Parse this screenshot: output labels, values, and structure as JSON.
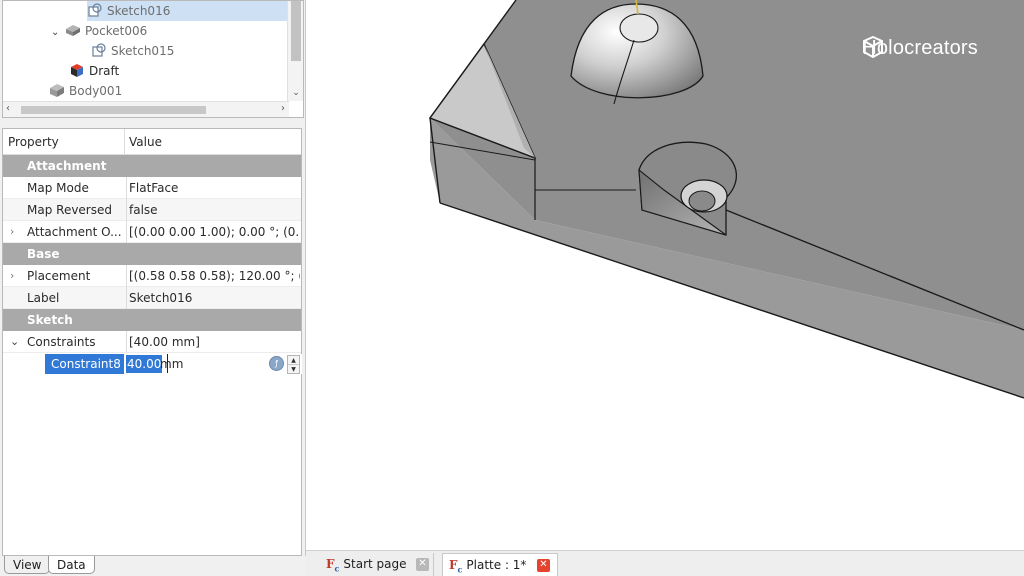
{
  "tree": {
    "items": [
      {
        "label": "Sketch016",
        "kind": "sketch"
      },
      {
        "label": "Pocket006",
        "kind": "pocket"
      },
      {
        "label": "Sketch015",
        "kind": "sketch"
      },
      {
        "label": "Draft",
        "kind": "draft"
      },
      {
        "label": "Body001",
        "kind": "body"
      }
    ]
  },
  "properties": {
    "header_property": "Property",
    "header_value": "Value",
    "groups": [
      {
        "name": "Attachment"
      },
      {
        "name": "Base"
      },
      {
        "name": "Sketch"
      }
    ],
    "rows": [
      {
        "name": "Map Mode",
        "value": "FlatFace"
      },
      {
        "name": "Map Reversed",
        "value": "false"
      },
      {
        "name": "Attachment O...",
        "value": "[(0.00 0.00 1.00); 0.00 °; (0.00 ..."
      },
      {
        "name": "Placement",
        "value": "[(0.58 0.58 0.58); 120.00 °; (0...."
      },
      {
        "name": "Label",
        "value": "Sketch016"
      },
      {
        "name": "Constraints",
        "value": "[40.00 mm]"
      }
    ],
    "editing": {
      "name": "Constraint8",
      "selected_value": "40.00",
      "unit": "mm"
    }
  },
  "bottom_tabs": [
    {
      "label": "View"
    },
    {
      "label": "Data"
    }
  ],
  "doc_tabs": [
    {
      "label": "Start page",
      "active": false
    },
    {
      "label": "Platte : 1*",
      "active": true
    }
  ],
  "watermark": {
    "text": "Holocreators"
  },
  "colors": {
    "selection": "#3079d6",
    "group_header": "#a9a9a9",
    "model_face": "#8f8f8f",
    "close_active": "#e4442f"
  },
  "icons": {
    "sketch": "sketch-icon",
    "pocket": "pocket-icon",
    "draft": "draft-icon",
    "body": "body-icon",
    "freecad": "freecad-icon",
    "logo": "cube-logo-icon"
  }
}
